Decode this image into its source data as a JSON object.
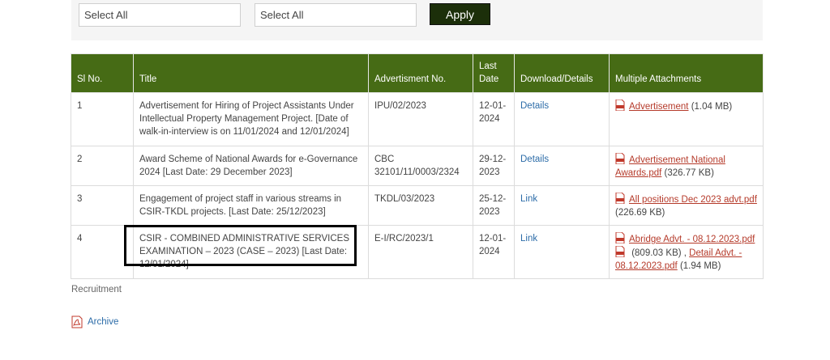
{
  "filters": {
    "select1_value": "Select All",
    "select2_value": "Select All",
    "apply_label": "Apply"
  },
  "table": {
    "headers": [
      "Sl No.",
      "Title",
      "Advertisment No.",
      "Last Date",
      "Download/Details",
      "Multiple Attachments"
    ],
    "rows": [
      {
        "sl": "1",
        "title": "Advertisement for Hiring of Project Assistants Under Intellectual Property Management Project. [Date of walk-in-interview is on 11/01/2024 and 12/01/2024]",
        "adv_no": "IPU/02/2023",
        "last_date": "12-01-2024",
        "details": "Details",
        "attachments": [
          {
            "name": "Advertisement",
            "size": " (1.04 MB)"
          }
        ]
      },
      {
        "sl": "2",
        "title": "Award Scheme of National Awards for e-Governance 2024 [Last Date: 29 December 2023]",
        "adv_no": "CBC 32101/11/0003/2324",
        "last_date": "29-12-2023",
        "details": "Details",
        "attachments": [
          {
            "name": "Advertisement National Awards.pdf",
            "size": " (326.77 KB)"
          }
        ]
      },
      {
        "sl": "3",
        "title": "Engagement of project staff in various streams in CSIR-TKDL projects. [Last Date: 25/12/2023]",
        "adv_no": "TKDL/03/2023",
        "last_date": "25-12-2023",
        "details": "Link",
        "attachments": [
          {
            "name": "All positions Dec 2023 advt.pdf",
            "size": " (226.69 KB)"
          }
        ]
      },
      {
        "sl": "4",
        "title": "CSIR - COMBINED ADMINISTRATIVE SERVICES EXAMINATION – 2023 (CASE – 2023) [Last Date: 12/01/2024]",
        "adv_no": "E-I/RC/2023/1",
        "last_date": "12-01-2024",
        "details": "Link",
        "attachments": [
          {
            "name": "Abridge Advt. - 08.12.2023.pdf",
            "size": " (809.03 KB) , "
          },
          {
            "name": "Detail Advt. - 08.12.2023.pdf",
            "size": " (1.94 MB)"
          }
        ]
      }
    ]
  },
  "footer": {
    "recruitment_label": "Recruitment",
    "archive_label": "Archive"
  },
  "colors": {
    "header_green": "#466b15",
    "apply_dark": "#1c2f0a",
    "link_blue": "#2c6ca8",
    "attachment_red": "#b53a2a"
  },
  "icons": {
    "pdf": "pdf-icon",
    "archive": "archive-icon"
  }
}
